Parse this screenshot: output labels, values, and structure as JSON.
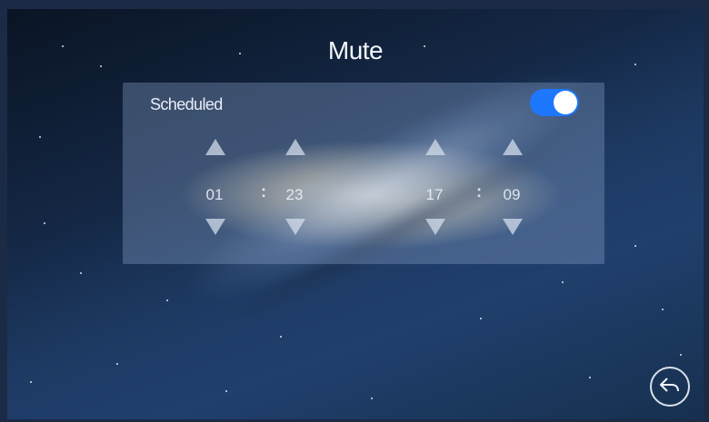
{
  "screen": {
    "title": "Mute"
  },
  "schedule": {
    "label": "Scheduled",
    "enabled": true,
    "start": {
      "hour": "01",
      "minute": "23"
    },
    "end": {
      "hour": "17",
      "minute": "09"
    },
    "separator": ":"
  },
  "icons": {
    "up": "arrow-up-icon",
    "down": "arrow-down-icon",
    "back": "back-icon"
  },
  "colors": {
    "accent": "#1e78ff"
  }
}
